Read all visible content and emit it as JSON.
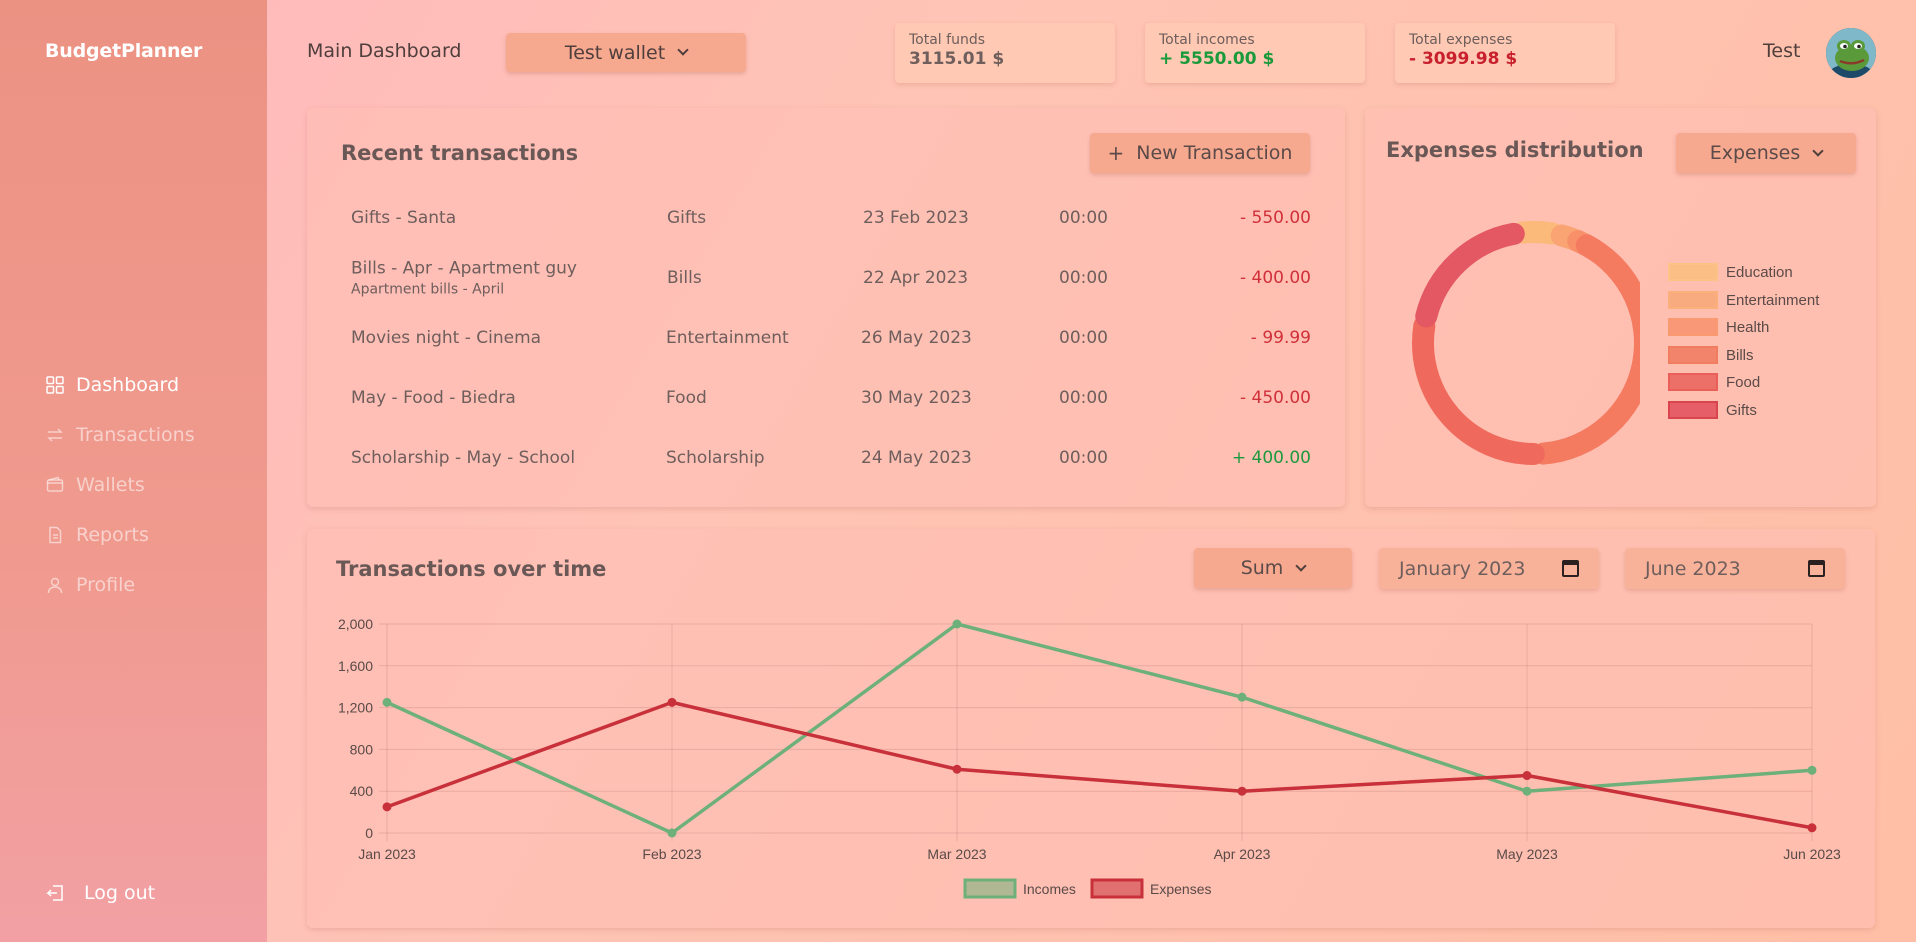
{
  "app": {
    "brand": "BudgetPlanner"
  },
  "sidebar": {
    "items": [
      {
        "label": "Dashboard",
        "icon": "grid-icon",
        "active": true
      },
      {
        "label": "Transactions",
        "icon": "transfer-icon",
        "active": false
      },
      {
        "label": "Wallets",
        "icon": "wallet-icon",
        "active": false
      },
      {
        "label": "Reports",
        "icon": "report-icon",
        "active": false
      },
      {
        "label": "Profile",
        "icon": "user-icon",
        "active": false
      }
    ],
    "logout_label": "Log out"
  },
  "header": {
    "title": "Main Dashboard",
    "wallet": "Test wallet",
    "stats": [
      {
        "label": "Total funds",
        "value": "3115.01 $",
        "tone": "neutral"
      },
      {
        "label": "Total incomes",
        "value": "+ 5550.00 $",
        "tone": "pos"
      },
      {
        "label": "Total expenses",
        "value": "- 3099.98 $",
        "tone": "neg"
      }
    ],
    "user": "Test"
  },
  "recent": {
    "title": "Recent transactions",
    "new_button": "New Transaction",
    "rows": [
      {
        "name": "Gifts - Santa",
        "note": "",
        "category": "Gifts",
        "date": "23 Feb 2023",
        "time": "00:00",
        "amount": "- 550.00",
        "tone": "neg"
      },
      {
        "name": "Bills - Apr - Apartment guy",
        "note": "Apartment bills - April",
        "category": "Bills",
        "date": "22 Apr 2023",
        "time": "00:00",
        "amount": "- 400.00",
        "tone": "neg"
      },
      {
        "name": "Movies night - Cinema",
        "note": "",
        "category": "Entertainment",
        "date": "26 May 2023",
        "time": "00:00",
        "amount": "- 99.99",
        "tone": "neg"
      },
      {
        "name": "May - Food - Biedra",
        "note": "",
        "category": "Food",
        "date": "30 May 2023",
        "time": "00:00",
        "amount": "- 450.00",
        "tone": "neg"
      },
      {
        "name": "Scholarship - May - School",
        "note": "",
        "category": "Scholarship",
        "date": "24 May 2023",
        "time": "00:00",
        "amount": "+ 400.00",
        "tone": "pos"
      }
    ]
  },
  "distribution": {
    "title": "Expenses distribution",
    "selector": "Expenses",
    "legend": [
      {
        "label": "Education",
        "color": "#fbb97a"
      },
      {
        "label": "Entertainment",
        "color": "#f9a472"
      },
      {
        "label": "Health",
        "color": "#f8916a"
      },
      {
        "label": "Bills",
        "color": "#f47a60"
      },
      {
        "label": "Food",
        "color": "#ef6a5c"
      },
      {
        "label": "Gifts",
        "color": "#e35862"
      }
    ],
    "slices": [
      {
        "label": "Education",
        "value": 5,
        "color": "#fbb97a"
      },
      {
        "label": "Entertainment",
        "value": 3.2,
        "color": "#f9a472"
      },
      {
        "label": "Health",
        "value": 0.3,
        "color": "#f8916a"
      },
      {
        "label": "Bills",
        "value": 38,
        "color": "#f47a60"
      },
      {
        "label": "Food",
        "value": 26,
        "color": "#ef6a5c"
      },
      {
        "label": "Gifts",
        "value": 17.7,
        "color": "#e35862"
      }
    ]
  },
  "overtime": {
    "title": "Transactions over time",
    "mode": "Sum",
    "from": "January 2023",
    "to": "June 2023"
  },
  "chart_data": {
    "type": "line",
    "categories": [
      "Jan 2023",
      "Feb 2023",
      "Mar 2023",
      "Apr 2023",
      "May 2023",
      "Jun 2023"
    ],
    "series": [
      {
        "name": "Incomes",
        "values": [
          1250,
          0,
          2000,
          1300,
          400,
          600
        ],
        "color": "#6db07a"
      },
      {
        "name": "Expenses",
        "values": [
          250,
          1250,
          610,
          400,
          550,
          50
        ],
        "color": "#c8303a"
      }
    ],
    "yticks": [
      "2,000",
      "1,600",
      "1,200",
      "800",
      "400",
      "0"
    ],
    "ylim": [
      0,
      2000
    ],
    "grid": true,
    "legend_position": "bottom"
  }
}
